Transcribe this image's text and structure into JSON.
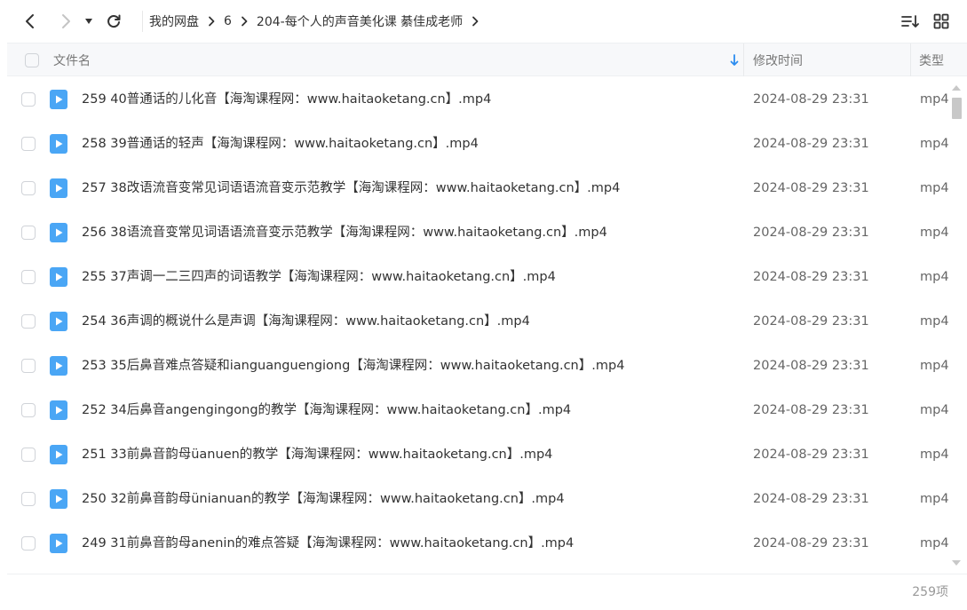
{
  "nav": {
    "back_icon": "chevron-left-icon",
    "forward_icon": "chevron-right-icon",
    "history_icon": "caret-down-icon",
    "refresh_icon": "refresh-icon",
    "breadcrumb": [
      "我的网盘",
      "6",
      "204-每个人的声音美化课 綦佳成老师"
    ],
    "sort_icon": "sort-list-icon",
    "grid_icon": "grid-view-icon"
  },
  "header": {
    "name_label": "文件名",
    "time_label": "修改时间",
    "type_label": "类型",
    "sort_icon": "sort-arrow-down-icon"
  },
  "files": [
    {
      "name": "259 40普通话的儿化音【海淘课程网：www.haitaoketang.cn】.mp4",
      "time": "2024-08-29 23:31",
      "type": "mp4"
    },
    {
      "name": "258 39普通话的轻声【海淘课程网：www.haitaoketang.cn】.mp4",
      "time": "2024-08-29 23:31",
      "type": "mp4"
    },
    {
      "name": "257 38改语流音变常见词语语流音变示范教学【海淘课程网：www.haitaoketang.cn】.mp4",
      "time": "2024-08-29 23:31",
      "type": "mp4"
    },
    {
      "name": "256 38语流音变常见词语语流音变示范教学【海淘课程网：www.haitaoketang.cn】.mp4",
      "time": "2024-08-29 23:31",
      "type": "mp4"
    },
    {
      "name": "255 37声调一二三四声的词语教学【海淘课程网：www.haitaoketang.cn】.mp4",
      "time": "2024-08-29 23:31",
      "type": "mp4"
    },
    {
      "name": "254 36声调的概说什么是声调【海淘课程网：www.haitaoketang.cn】.mp4",
      "time": "2024-08-29 23:31",
      "type": "mp4"
    },
    {
      "name": "253 35后鼻音难点答疑和ianguanguengiong【海淘课程网：www.haitaoketang.cn】.mp4",
      "time": "2024-08-29 23:31",
      "type": "mp4"
    },
    {
      "name": "252 34后鼻音angengingong的教学【海淘课程网：www.haitaoketang.cn】.mp4",
      "time": "2024-08-29 23:31",
      "type": "mp4"
    },
    {
      "name": "251 33前鼻音韵母üanuen的教学【海淘课程网：www.haitaoketang.cn】.mp4",
      "time": "2024-08-29 23:31",
      "type": "mp4"
    },
    {
      "name": "250 32前鼻音韵母ünianuan的教学【海淘课程网：www.haitaoketang.cn】.mp4",
      "time": "2024-08-29 23:31",
      "type": "mp4"
    },
    {
      "name": "249 31前鼻音韵母anenin的难点答疑【海淘课程网：www.haitaoketang.cn】.mp4",
      "time": "2024-08-29 23:31",
      "type": "mp4"
    }
  ],
  "footer": {
    "count": "259项"
  },
  "colors": {
    "file_icon": "#4aa6f5",
    "sort_arrow": "#2b8cf0"
  }
}
